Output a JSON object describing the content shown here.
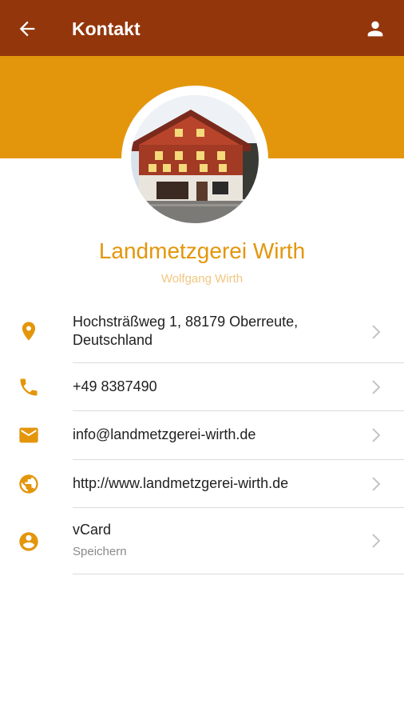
{
  "appbar": {
    "title": "Kontakt",
    "back_icon": "arrow-left-icon",
    "profile_icon": "person-icon",
    "color": "#93360c"
  },
  "banner": {
    "color": "#e3960c"
  },
  "profile": {
    "name": "Landmetzgerei Wirth",
    "owner": "Wolfgang Wirth",
    "photo_icon": "building-photo"
  },
  "contacts": [
    {
      "icon": "location-pin-icon",
      "line1": "Hochsträßweg 1, 88179 Oberreute,",
      "line2": "Deutschland"
    },
    {
      "icon": "phone-icon",
      "text": "+49 8387490"
    },
    {
      "icon": "email-icon",
      "text": "info@landmetzgerei-wirth.de"
    },
    {
      "icon": "globe-icon",
      "text": "http://www.landmetzgerei-wirth.de"
    },
    {
      "icon": "account-circle-icon",
      "text": "vCard",
      "sub": "Speichern"
    }
  ]
}
